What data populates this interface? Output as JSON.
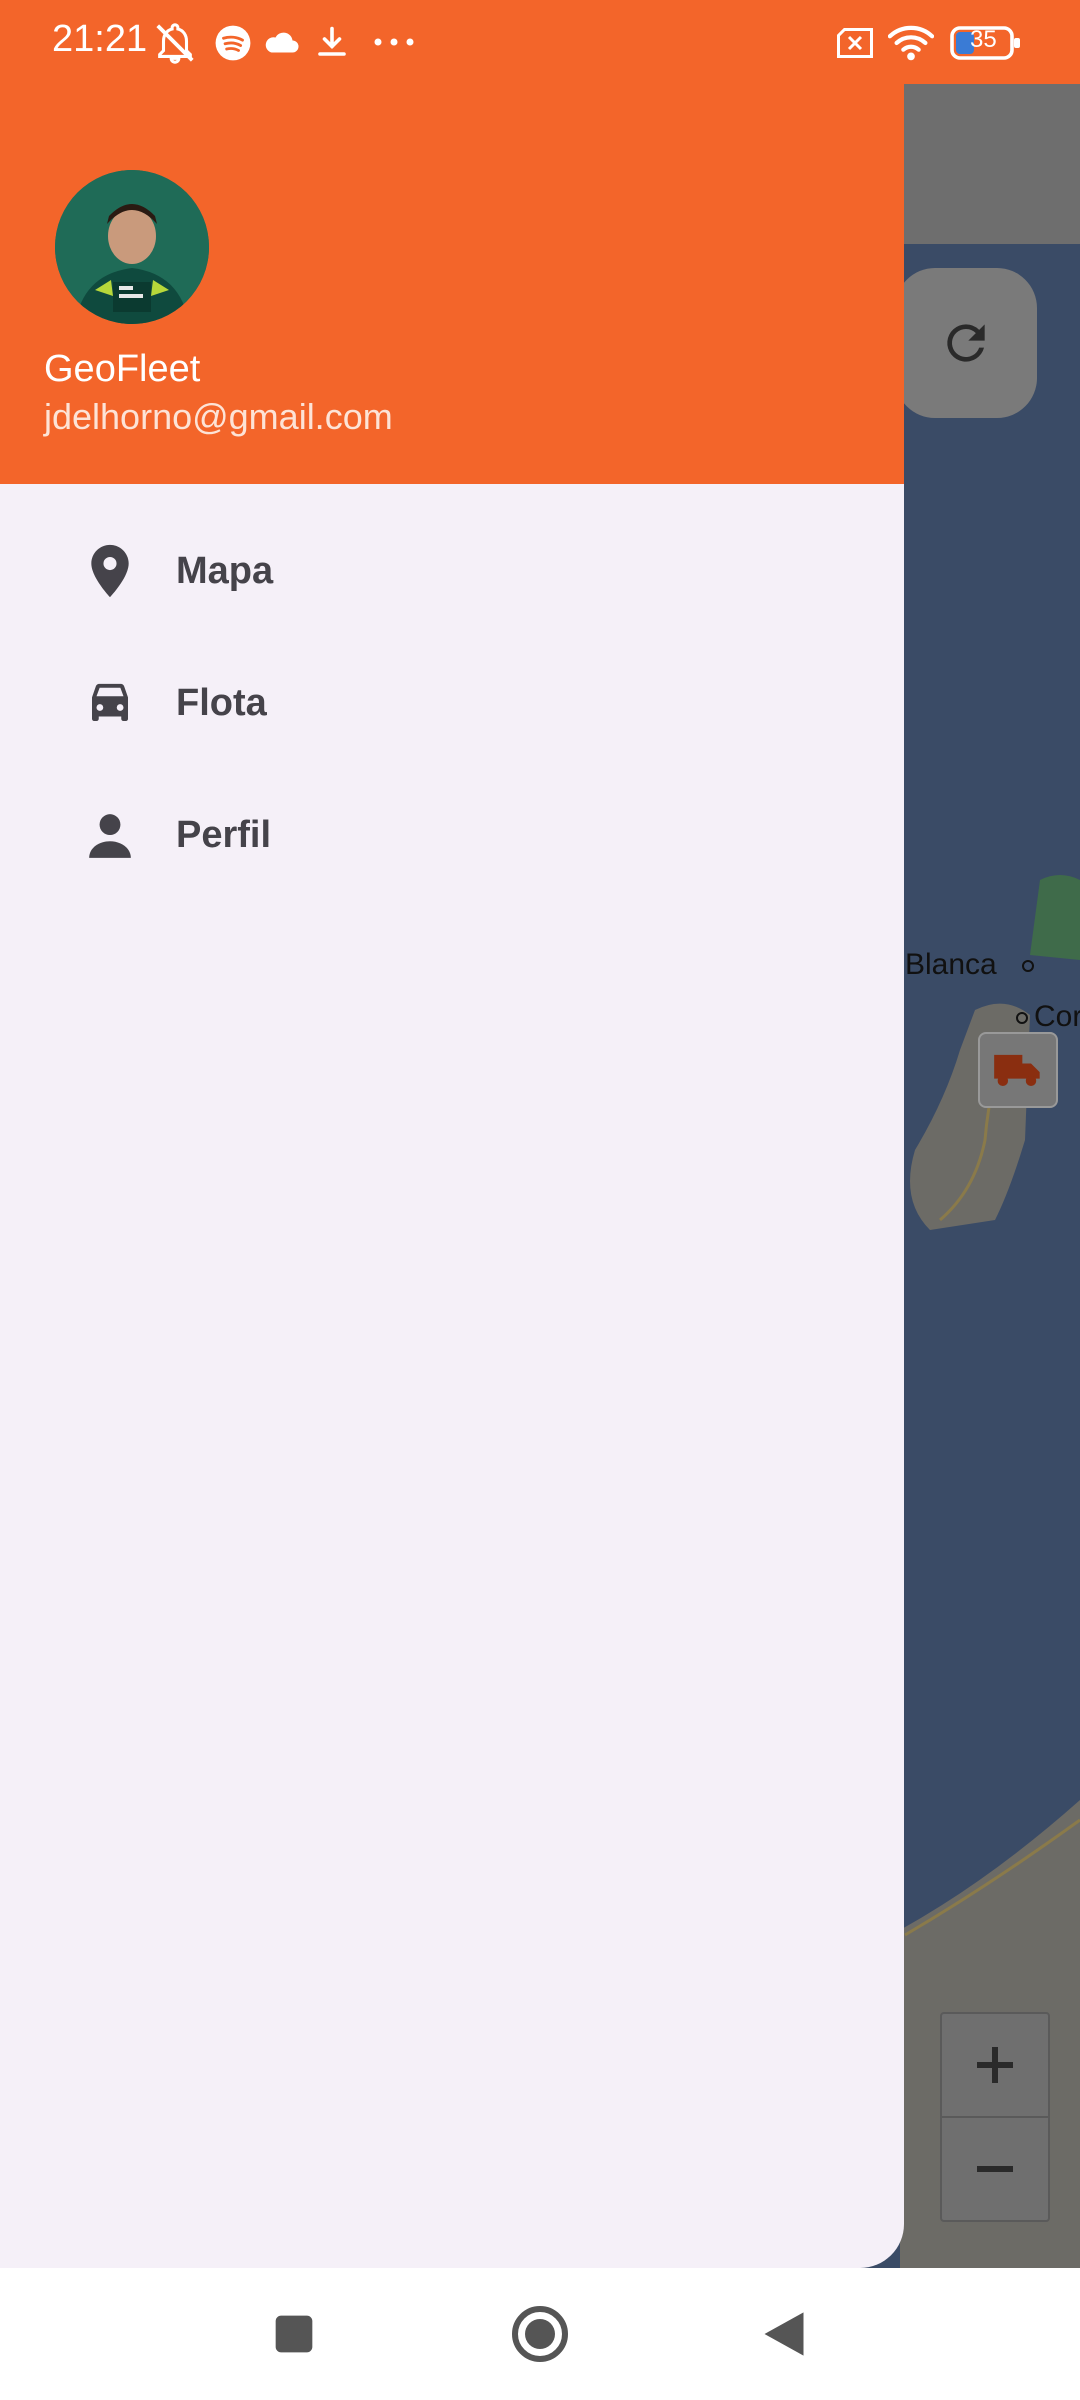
{
  "status_bar": {
    "time": "21:21",
    "battery": "35",
    "left_icons": [
      "notifications-muted-icon",
      "spotify-icon",
      "cloud-icon",
      "download-icon",
      "more-icon"
    ],
    "right_icons": [
      "no-sim-icon",
      "wifi-icon",
      "battery-icon"
    ]
  },
  "drawer": {
    "header": {
      "app_name": "GeoFleet",
      "email": "jdelhorno@gmail.com",
      "background_color": "#f3652a"
    },
    "items": [
      {
        "label": "Mapa",
        "icon": "location-pin-icon"
      },
      {
        "label": "Flota",
        "icon": "car-icon"
      },
      {
        "label": "Perfil",
        "icon": "person-icon"
      }
    ]
  },
  "map": {
    "labels": [
      "Blanca",
      "Cor"
    ],
    "marker_icon": "truck-icon",
    "zoom_in": "+",
    "zoom_out": "−"
  },
  "colors": {
    "accent": "#f3652a",
    "drawer_background": "#f5f0f8",
    "item_text": "#45434a",
    "water": "#3a4b66"
  }
}
